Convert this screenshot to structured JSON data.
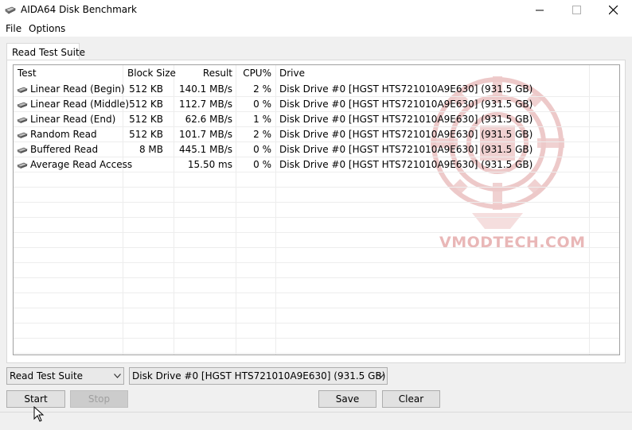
{
  "window": {
    "title": "AIDA64 Disk Benchmark",
    "icon": "disk-drive-icon"
  },
  "menu": {
    "items": [
      {
        "label": "File"
      },
      {
        "label": "Options"
      }
    ]
  },
  "tab": {
    "label": "Read Test Suite"
  },
  "table": {
    "columns": [
      "Test",
      "Block Size",
      "Result",
      "CPU%",
      "Drive"
    ],
    "rows": [
      {
        "test": "Linear Read (Begin)",
        "block": "512 KB",
        "result": "140.1 MB/s",
        "cpu": "2 %",
        "drive": "Disk Drive #0  [HGST HTS721010A9E630]  (931.5 GB)"
      },
      {
        "test": "Linear Read (Middle)",
        "block": "512 KB",
        "result": "112.7 MB/s",
        "cpu": "0 %",
        "drive": "Disk Drive #0  [HGST HTS721010A9E630]  (931.5 GB)"
      },
      {
        "test": "Linear Read (End)",
        "block": "512 KB",
        "result": "62.6 MB/s",
        "cpu": "1 %",
        "drive": "Disk Drive #0  [HGST HTS721010A9E630]  (931.5 GB)"
      },
      {
        "test": "Random Read",
        "block": "512 KB",
        "result": "101.7 MB/s",
        "cpu": "2 %",
        "drive": "Disk Drive #0  [HGST HTS721010A9E630]  (931.5 GB)"
      },
      {
        "test": "Buffered Read",
        "block": "8 MB",
        "result": "445.1 MB/s",
        "cpu": "0 %",
        "drive": "Disk Drive #0  [HGST HTS721010A9E630]  (931.5 GB)"
      },
      {
        "test": "Average Read Access",
        "block": "",
        "result": "15.50 ms",
        "cpu": "0 %",
        "drive": "Disk Drive #0  [HGST HTS721010A9E630]  (931.5 GB)"
      }
    ]
  },
  "watermark": {
    "text": "VMODTECH.COM"
  },
  "controls": {
    "suite_select": "Read Test Suite",
    "drive_select": "Disk Drive #0  [HGST HTS721010A9E630]  (931.5 GB)",
    "start_label": "Start",
    "stop_label": "Stop",
    "save_label": "Save",
    "clear_label": "Clear"
  },
  "colors": {
    "background": "#f0f0f0",
    "watermark": "#e9b7b7"
  }
}
